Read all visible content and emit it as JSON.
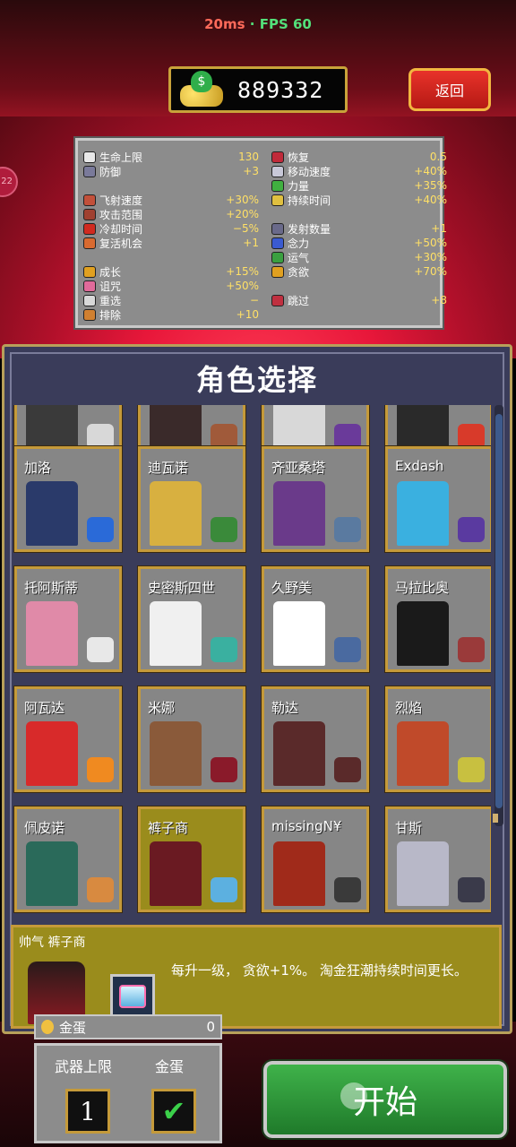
{
  "status": {
    "ping": "20ms",
    "separator": "·",
    "fps": "FPS 60"
  },
  "header": {
    "coins": "889332",
    "back_label": "返回"
  },
  "side_badge": "22",
  "stats": {
    "left": [
      {
        "name": "生命上限",
        "value": "130",
        "color": "#e8e8e8"
      },
      {
        "name": "防御",
        "value": "+3",
        "color": "#7a7a9a"
      },
      {
        "name": "飞射速度",
        "value": "+30%",
        "color": "#c2503a",
        "gap": true
      },
      {
        "name": "攻击范围",
        "value": "+20%",
        "color": "#a04030"
      },
      {
        "name": "冷却时间",
        "value": "−5%",
        "color": "#d02a20"
      },
      {
        "name": "复活机会",
        "value": "+1",
        "color": "#d86a30"
      },
      {
        "name": "成长",
        "value": "+15%",
        "color": "#e0a020",
        "gap": true
      },
      {
        "name": "诅咒",
        "value": "+50%",
        "color": "#e06a9a"
      },
      {
        "name": "重选",
        "value": "−",
        "color": "#d8d8d8"
      },
      {
        "name": "排除",
        "value": "+10",
        "color": "#d08030"
      }
    ],
    "right": [
      {
        "name": "恢复",
        "value": "0.5",
        "color": "#c02a3a"
      },
      {
        "name": "移动速度",
        "value": "+40%",
        "color": "#c8c8d8"
      },
      {
        "name": "力量",
        "value": "+35%",
        "color": "#40b040"
      },
      {
        "name": "持续时间",
        "value": "+40%",
        "color": "#e0c040"
      },
      {
        "name": "发射数量",
        "value": "+1",
        "color": "#6a6a8a",
        "gap": true
      },
      {
        "name": "念力",
        "value": "+50%",
        "color": "#3a5ad0"
      },
      {
        "name": "运气",
        "value": "+30%",
        "color": "#3aa040"
      },
      {
        "name": "贪欲",
        "value": "+70%",
        "color": "#e0a020"
      },
      {
        "name": "跳过",
        "value": "+8",
        "color": "#c03040",
        "gap": true
      }
    ]
  },
  "panel_title": "角色选择",
  "characters": [
    {
      "name": "",
      "sprite": "#3a3a3a",
      "item": "#d8d8d8",
      "row": 0,
      "col": 0
    },
    {
      "name": "",
      "sprite": "#3a2a2a",
      "item": "#a05a3a",
      "row": 0,
      "col": 1
    },
    {
      "name": "",
      "sprite": "#d8d8d8",
      "item": "#6a3a9a",
      "row": 0,
      "col": 2
    },
    {
      "name": "",
      "sprite": "#2a2a2a",
      "item": "#d83a2a",
      "row": 0,
      "col": 3
    },
    {
      "name": "加洛",
      "sprite": "#2a3a6a",
      "item": "#2a6ad8",
      "row": 1,
      "col": 0
    },
    {
      "name": "迪瓦诺",
      "sprite": "#d8b040",
      "item": "#3a8a3a",
      "row": 1,
      "col": 1
    },
    {
      "name": "齐亚桑塔",
      "sprite": "#6a3a8a",
      "item": "#5a7aa0",
      "row": 1,
      "col": 2
    },
    {
      "name": "Exdash",
      "sprite": "#3ab0e0",
      "item": "#5a3aa0",
      "row": 1,
      "col": 3
    },
    {
      "name": "托阿斯蒂",
      "sprite": "#e08aa8",
      "item": "#e8e8e8",
      "row": 2,
      "col": 0
    },
    {
      "name": "史密斯四世",
      "sprite": "#f0f0f0",
      "item": "#3ab0a0",
      "row": 2,
      "col": 1
    },
    {
      "name": "久野美",
      "sprite": "#ffffff",
      "item": "#4a6aa0",
      "row": 2,
      "col": 2
    },
    {
      "name": "马拉比奥",
      "sprite": "#1a1a1a",
      "item": "#9a3a3a",
      "row": 2,
      "col": 3
    },
    {
      "name": "阿瓦达",
      "sprite": "#d82a2a",
      "item": "#f08a20",
      "row": 3,
      "col": 0
    },
    {
      "name": "米娜",
      "sprite": "#8a5a3a",
      "item": "#8a1a2a",
      "row": 3,
      "col": 1
    },
    {
      "name": "勒达",
      "sprite": "#5a2a2a",
      "item": "#5a2a2a",
      "row": 3,
      "col": 2
    },
    {
      "name": "烈焰",
      "sprite": "#c04a2a",
      "item": "#c8c040",
      "row": 3,
      "col": 3
    },
    {
      "name": "佩皮诺",
      "sprite": "#2a6a5a",
      "item": "#d88a40",
      "row": 4,
      "col": 0
    },
    {
      "name": "裤子商",
      "sprite": "#6a1a22",
      "item": "#5cb0e0",
      "row": 4,
      "col": 1,
      "selected": true
    },
    {
      "name": "missingN¥",
      "sprite": "#a02a1a",
      "item": "#3a3a3a",
      "row": 4,
      "col": 2
    },
    {
      "name": "甘斯",
      "sprite": "#b8b8c8",
      "item": "#3a3a4a",
      "row": 4,
      "col": 3
    }
  ],
  "selected": {
    "title": "帅气 裤子商",
    "description": "每升一级， 贪欲+1%。 淘金狂潮持续时间更长。"
  },
  "gold_egg": {
    "label": "金蛋",
    "value": "0"
  },
  "options": {
    "weapon_limit_label": "武器上限",
    "weapon_limit_value": "1",
    "gold_egg_label": "金蛋",
    "gold_egg_checked": "✔"
  },
  "start_label": "开始"
}
